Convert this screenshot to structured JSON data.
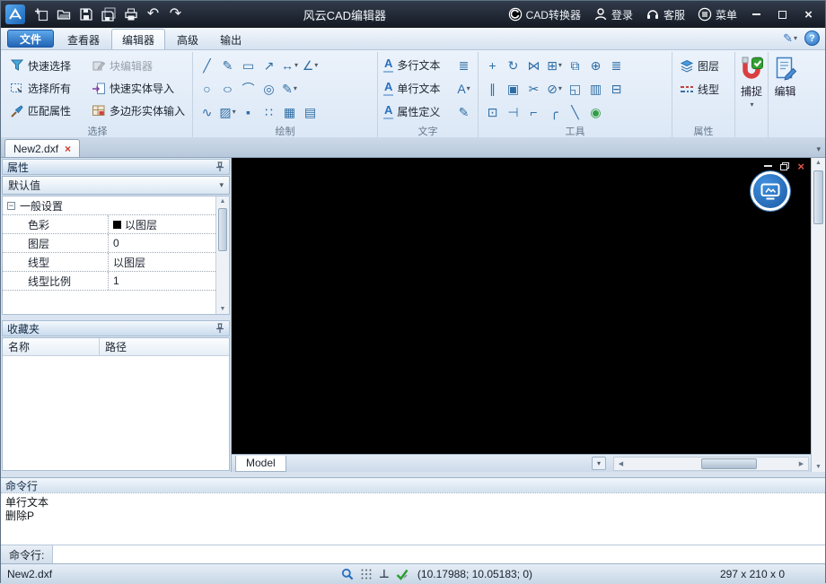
{
  "titlebar": {
    "title": "风云CAD编辑器",
    "converter": "CAD转换器",
    "login": "登录",
    "service": "客服",
    "menu": "菜单"
  },
  "tabs": {
    "file": "文件",
    "viewer": "查看器",
    "editor": "编辑器",
    "advanced": "高级",
    "output": "输出"
  },
  "ribbon": {
    "select": {
      "label": "选择",
      "quick_select": "快速选择",
      "block_editor": "块编辑器",
      "select_all": "选择所有",
      "quick_import": "快速实体导入",
      "match_props": "匹配属性",
      "polygon_input": "多边形实体输入"
    },
    "draw": {
      "label": "绘制"
    },
    "text": {
      "label": "文字",
      "mtext": "多行文本",
      "stext": "单行文本",
      "attrdef": "属性定义"
    },
    "tools": {
      "label": "工具"
    },
    "props": {
      "label": "属性",
      "layers": "图层",
      "linetype": "线型"
    },
    "snap": "捕捉",
    "edit": "编辑"
  },
  "doctab": {
    "name": "New2.dxf"
  },
  "props_panel": {
    "title": "属性",
    "preset": "默认值",
    "group": "一般设置",
    "rows": [
      {
        "label": "色彩",
        "value": "以图层"
      },
      {
        "label": "图层",
        "value": "0"
      },
      {
        "label": "线型",
        "value": "以图层"
      },
      {
        "label": "线型比例",
        "value": "1"
      }
    ]
  },
  "favorites": {
    "title": "收藏夹",
    "col_name": "名称",
    "col_path": "路径"
  },
  "canvas": {
    "model_tab": "Model"
  },
  "cmd": {
    "title": "命令行",
    "history": [
      "单行文本",
      "删除P"
    ],
    "prompt": "命令行:"
  },
  "status": {
    "filename": "New2.dxf",
    "coords": "(10.17988; 10.05183; 0)",
    "size": "297 x 210 x 0"
  },
  "icons": {
    "undo": "↶",
    "redo": "↷",
    "close": "×",
    "min": "—",
    "dropdown": "▾",
    "help": "?",
    "pencil": "✎",
    "collapse": "−",
    "line": "╱",
    "freehand": "✎",
    "rectangle": "▭",
    "ray": "↗",
    "dim_linear": "↔",
    "dim_angular": "∠",
    "circle": "○",
    "ellipse": "○",
    "arc": "⌒",
    "donut": "◎",
    "revision": "✎",
    "spline": "∿",
    "hatch": "▨",
    "solid": "▪",
    "point": "∷",
    "region": "▦",
    "table": "▤",
    "move": "+",
    "rotate": "↻",
    "mirror": "⋈",
    "array": "⊞",
    "copy": "⧉",
    "paste": "⊕",
    "list": "≣",
    "offset": "∥",
    "block": "▣",
    "cut": "✂",
    "erase": "⊘",
    "scale": "◱",
    "gridtool": "▥",
    "explode": "⊟",
    "stretch": "⊡",
    "extend": "⊣",
    "trim": "⌐",
    "fillet": "╭",
    "chamfer": "╲",
    "osnap": "◉",
    "text_a": "A",
    "align": "≣",
    "ortho": "⊥",
    "up": "▲",
    "down": "▼",
    "left": "◀",
    "right": "▶"
  }
}
